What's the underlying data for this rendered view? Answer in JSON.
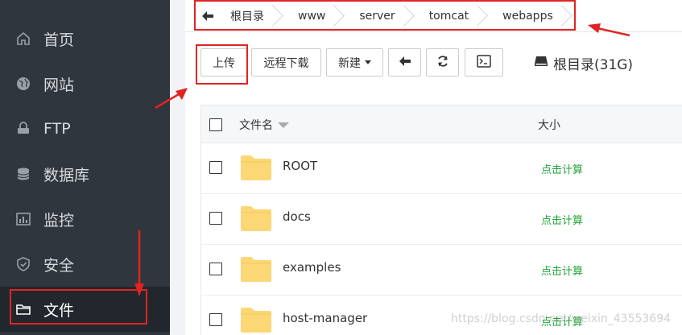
{
  "sidebar": {
    "items": [
      {
        "label": "首页",
        "icon": "home-icon"
      },
      {
        "label": "网站",
        "icon": "globe-icon"
      },
      {
        "label": "FTP",
        "icon": "ftp-icon"
      },
      {
        "label": "数据库",
        "icon": "database-icon"
      },
      {
        "label": "监控",
        "icon": "monitor-icon"
      },
      {
        "label": "安全",
        "icon": "shield-icon"
      },
      {
        "label": "文件",
        "icon": "folder-icon",
        "active": true
      }
    ]
  },
  "breadcrumb": {
    "items": [
      "根目录",
      "www",
      "server",
      "tomcat",
      "webapps"
    ]
  },
  "toolbar": {
    "upload": "上传",
    "remote_download": "远程下载",
    "new": "新建"
  },
  "disk": {
    "label": "根目录(31G)"
  },
  "table": {
    "col_name": "文件名",
    "col_size": "大小",
    "rows": [
      {
        "name": "ROOT",
        "size": "点击计算"
      },
      {
        "name": "docs",
        "size": "点击计算"
      },
      {
        "name": "examples",
        "size": "点击计算"
      },
      {
        "name": "host-manager",
        "size": "点击计算"
      }
    ]
  },
  "watermark": "https://blog.csdn.net/weixin_43553694",
  "colors": {
    "sidebar_bg": "#30363e",
    "active_bg": "#22272d",
    "link_green": "#20a53a",
    "annotation_red": "#e02424",
    "folder_yellow": "#fbd775"
  }
}
